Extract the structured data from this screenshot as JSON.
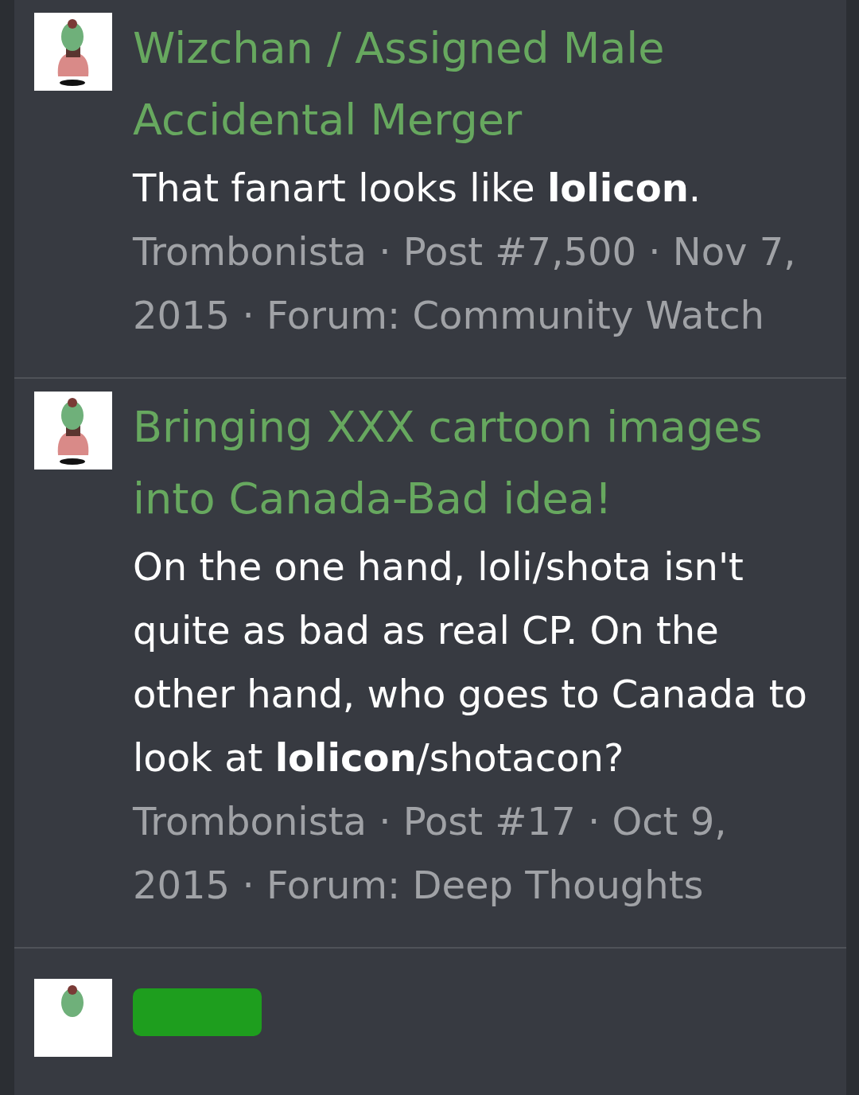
{
  "results": [
    {
      "title": "Wizchan / Assigned Male Accidental Merger",
      "snippet": "That fanart looks like **lolicon**.",
      "meta": "Trombonista · Post #7,500 · Nov 7, 2015 · Forum: Community Watch"
    },
    {
      "title": "Bringing XXX cartoon images into Canada-Bad idea!",
      "snippet": "On the one hand, loli/shota isn't quite as bad as real CP. On the other hand, who goes to Canada to look at **lolicon**/shotacon?",
      "meta": "Trombonista · Post #17 · Oct 9, 2015 · Forum: Deep Thoughts"
    }
  ],
  "next_result_peek": true
}
